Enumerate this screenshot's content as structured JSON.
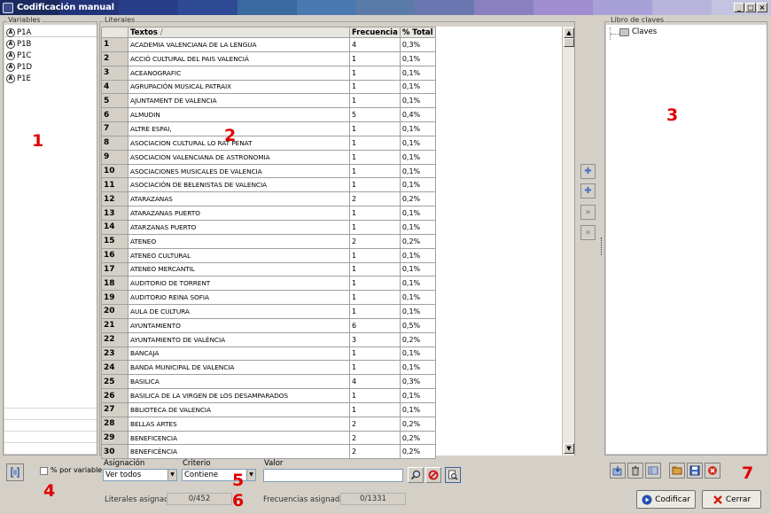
{
  "window": {
    "title": "Codificación manual",
    "min": "_",
    "max": "□",
    "close": "×"
  },
  "title_gradient": [
    "#1a2a5e",
    "#22357a",
    "#283e8a",
    "#2e4a95",
    "#3b6aa0",
    "#4a78b0",
    "#5a7aa8",
    "#6a76b0",
    "#8a80c0",
    "#9e8ed0",
    "#a8a0d8",
    "#b8b4dc",
    "#c4c4e0"
  ],
  "variables": {
    "label": "Variables",
    "items": [
      {
        "name": "P1A",
        "icon": "text-variable-icon"
      },
      {
        "name": "P1B",
        "icon": "text-variable-icon"
      },
      {
        "name": "P1C",
        "icon": "text-variable-icon"
      },
      {
        "name": "P1D",
        "icon": "text-variable-icon"
      },
      {
        "name": "P1E",
        "icon": "text-variable-icon"
      }
    ],
    "pct_checkbox": "% por variable",
    "checked": false
  },
  "literales": {
    "label": "Literales",
    "headers": {
      "num": "",
      "text": "Textos",
      "sort": "/",
      "freq": "Frecuencia",
      "pct": "% Total"
    },
    "rows": [
      {
        "n": "1",
        "t": "ACADEMIA VALENCIANA DE LA LENGUA",
        "f": "4",
        "p": "0,3%"
      },
      {
        "n": "2",
        "t": "ACCIÓ CULTURAL DEL PAIS VALENCIÀ",
        "f": "1",
        "p": "0,1%"
      },
      {
        "n": "3",
        "t": "ACEANOGRAFIC",
        "f": "1",
        "p": "0,1%"
      },
      {
        "n": "4",
        "t": "AGRUPACIÓN MUSICAL PATRAIX",
        "f": "1",
        "p": "0,1%"
      },
      {
        "n": "5",
        "t": "AJUNTAMENT DE VALENCIA",
        "f": "1",
        "p": "0,1%"
      },
      {
        "n": "6",
        "t": "ALMUDIN",
        "f": "5",
        "p": "0,4%"
      },
      {
        "n": "7",
        "t": "ALTRE ESPAI,",
        "f": "1",
        "p": "0,1%"
      },
      {
        "n": "8",
        "t": "ASOCIACION CULTURAL LO RAT PENAT",
        "f": "1",
        "p": "0,1%"
      },
      {
        "n": "9",
        "t": "ASOCIACION VALENCIANA DE ASTRONOMIA",
        "f": "1",
        "p": "0,1%"
      },
      {
        "n": "10",
        "t": "ASOCIACIONES MUSICALES DE VALENCIA",
        "f": "1",
        "p": "0,1%"
      },
      {
        "n": "11",
        "t": "ASOCIACIÓN DE BELENISTAS DE VALENCIA",
        "f": "1",
        "p": "0,1%"
      },
      {
        "n": "12",
        "t": "ATARAZANAS",
        "f": "2",
        "p": "0,2%"
      },
      {
        "n": "13",
        "t": "ATARAZANAS PUERTO",
        "f": "1",
        "p": "0,1%"
      },
      {
        "n": "14",
        "t": "ATARZANAS PUERTO",
        "f": "1",
        "p": "0,1%"
      },
      {
        "n": "15",
        "t": "ATENEO",
        "f": "2",
        "p": "0,2%"
      },
      {
        "n": "16",
        "t": "ATENEO CULTURAL",
        "f": "1",
        "p": "0,1%"
      },
      {
        "n": "17",
        "t": "ATENEO MERCANTIL",
        "f": "1",
        "p": "0,1%"
      },
      {
        "n": "18",
        "t": "AUDITORIO DE TORRENT",
        "f": "1",
        "p": "0,1%"
      },
      {
        "n": "19",
        "t": "AUDITORIO REINA SOFIA",
        "f": "1",
        "p": "0,1%"
      },
      {
        "n": "20",
        "t": "AULA DE CULTURA",
        "f": "1",
        "p": "0,1%"
      },
      {
        "n": "21",
        "t": "AYUNTAMIENTO",
        "f": "6",
        "p": "0,5%"
      },
      {
        "n": "22",
        "t": "AYUNTAMIENTO DE VALÈNCIA",
        "f": "3",
        "p": "0,2%"
      },
      {
        "n": "23",
        "t": "BANCAJA",
        "f": "1",
        "p": "0,1%"
      },
      {
        "n": "24",
        "t": "BANDA MUNICIPAL DE VALENCIA",
        "f": "1",
        "p": "0,1%"
      },
      {
        "n": "25",
        "t": "BASILICA",
        "f": "4",
        "p": "0,3%"
      },
      {
        "n": "26",
        "t": "BASILICA DE LA VIRGEN DE LOS DESAMPARADOS",
        "f": "1",
        "p": "0,1%"
      },
      {
        "n": "27",
        "t": "BBLIOTECA DE VALENCIA",
        "f": "1",
        "p": "0,1%"
      },
      {
        "n": "28",
        "t": "BELLAS ARTES",
        "f": "2",
        "p": "0,2%"
      },
      {
        "n": "29",
        "t": "BENEFICENCIA",
        "f": "2",
        "p": "0,2%"
      },
      {
        "n": "30",
        "t": "BENEFICÈNCIA",
        "f": "2",
        "p": "0,2%"
      }
    ]
  },
  "middle_buttons": [
    {
      "icon": "add-code-icon",
      "glyph": "✚"
    },
    {
      "icon": "add-subcode-icon",
      "glyph": "✚"
    },
    {
      "icon": "arrow-right-icon",
      "glyph": "»"
    },
    {
      "icon": "arrow-left-icon",
      "glyph": "«"
    }
  ],
  "libro": {
    "label": "Libro de claves",
    "root": "Claves"
  },
  "filter": {
    "asignacion_label": "Asignación",
    "asignacion_value": "Ver todos",
    "criterio_label": "Criterio",
    "criterio_value": "Contiene",
    "valor_label": "Valor",
    "valor_value": ""
  },
  "status": {
    "literales_label": "Literales asignados:",
    "literales_value": "0/452",
    "frecuencias_label": "Frecuencias asignadas:",
    "frecuencias_value": "0/1331"
  },
  "buttons": {
    "codificar": "Codificar",
    "cerrar": "Cerrar"
  },
  "annotations": [
    "1",
    "2",
    "3",
    "4",
    "5",
    "6",
    "7"
  ]
}
